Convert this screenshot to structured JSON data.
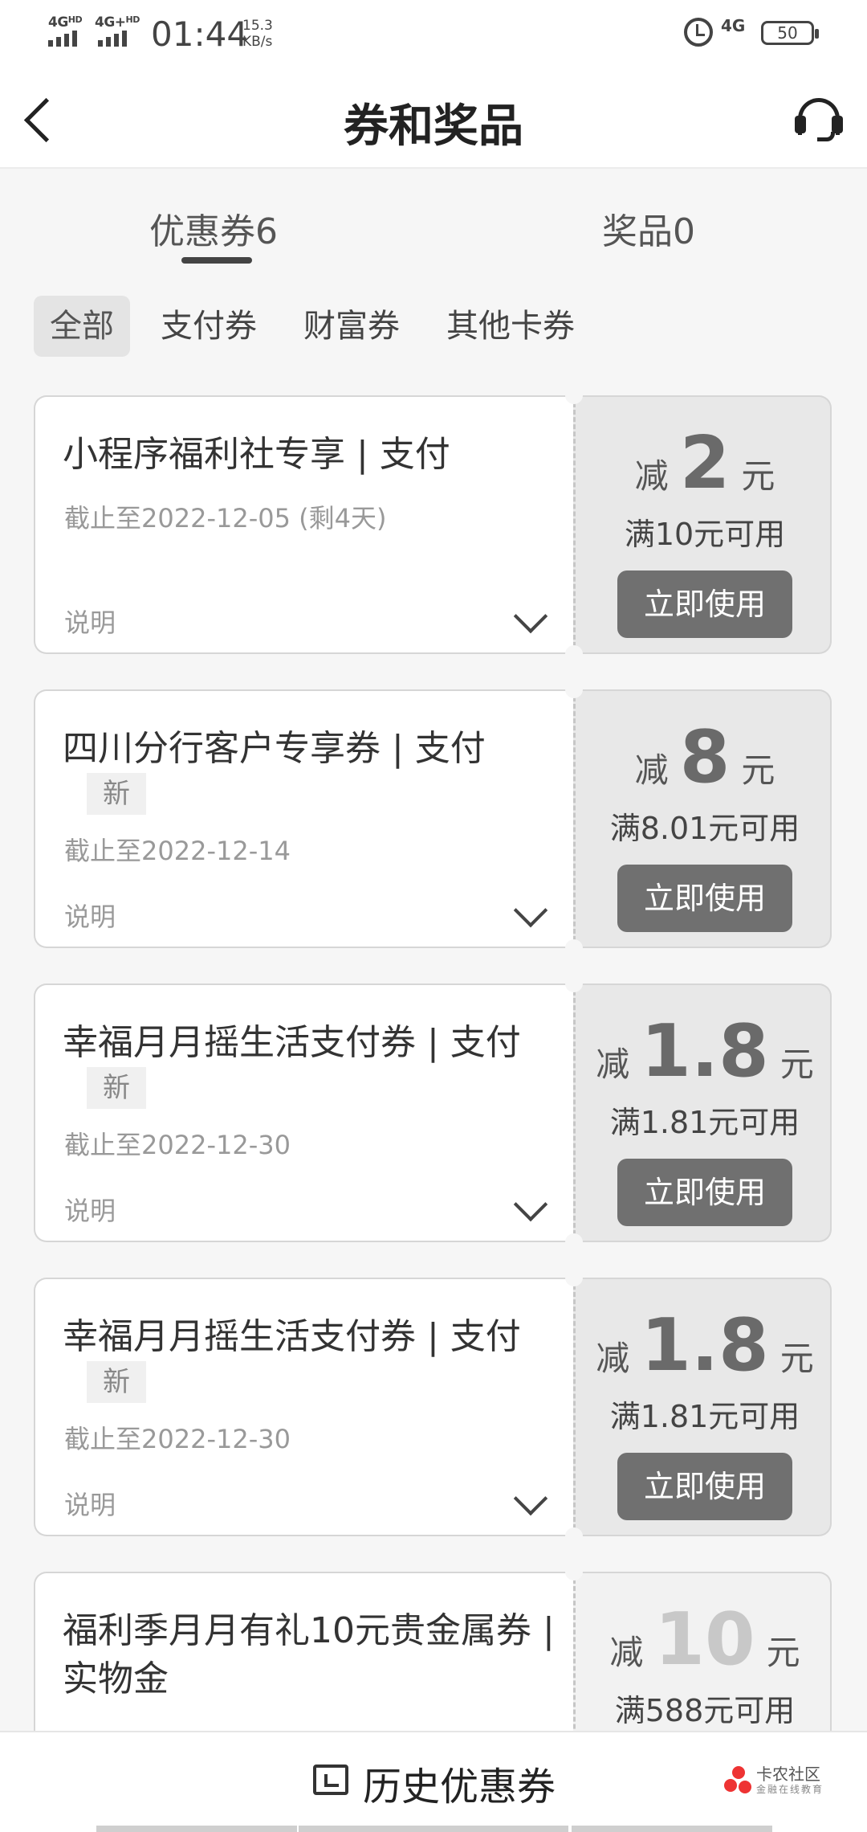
{
  "status_bar": {
    "signal1": "4G",
    "signal1_sup": "HD",
    "signal2": "4G+",
    "signal2_sup": "HD",
    "time": "01:44",
    "speed_value": "15.3",
    "speed_unit": "KB/s",
    "network": "4G",
    "battery": "50"
  },
  "header": {
    "title": "券和奖品"
  },
  "tabs": [
    {
      "label": "优惠券6",
      "active": true
    },
    {
      "label": "奖品0",
      "active": false
    }
  ],
  "filters": [
    "全部",
    "支付券",
    "财富券",
    "其他卡券"
  ],
  "coupons": [
    {
      "title": "小程序福利社专享 | 支付",
      "tag": "",
      "expiry": "截止至2022-12-05  (剩4天)",
      "note": "说明",
      "cut_label": "减",
      "amount": "2",
      "unit": "元",
      "condition": "满10元可用",
      "button": "立即使用"
    },
    {
      "title": "四川分行客户专享券 | 支付",
      "tag": "新",
      "expiry": "截止至2022-12-14",
      "note": "说明",
      "cut_label": "减",
      "amount": "8",
      "unit": "元",
      "condition": "满8.01元可用",
      "button": "立即使用"
    },
    {
      "title": "幸福月月摇生活支付券 | 支付",
      "tag": "新",
      "expiry": "截止至2022-12-30",
      "note": "说明",
      "cut_label": "减",
      "amount": "1.8",
      "unit": "元",
      "condition": "满1.81元可用",
      "button": "立即使用"
    },
    {
      "title": "幸福月月摇生活支付券 | 支付",
      "tag": "新",
      "expiry": "截止至2022-12-30",
      "note": "说明",
      "cut_label": "减",
      "amount": "1.8",
      "unit": "元",
      "condition": "满1.81元可用",
      "button": "立即使用"
    },
    {
      "title": "福利季月月有礼10元贵金属券 | 实物金",
      "cut_label": "减",
      "amount": "10",
      "unit": "元",
      "condition": "满588元可用"
    }
  ],
  "bottom_bar": {
    "history_label": "历史优惠券",
    "watermark_name": "卡农社区",
    "watermark_sub": "金融在线教育"
  }
}
